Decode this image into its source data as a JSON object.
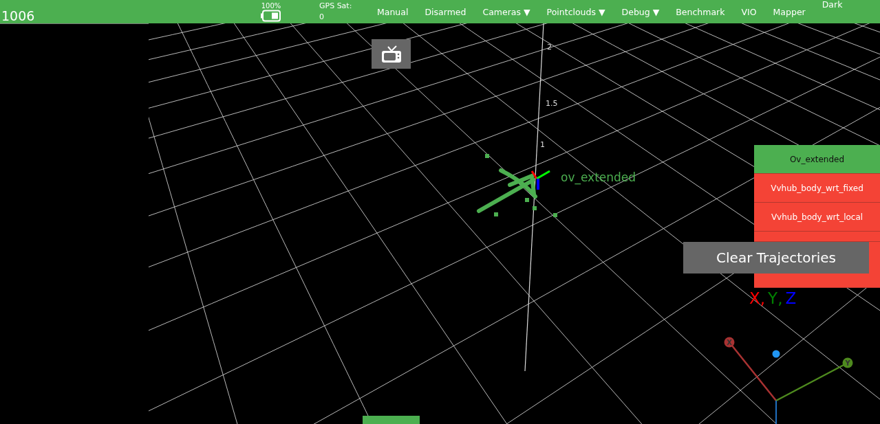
{
  "navbar": {
    "reading": "1006",
    "battery_label": "100%",
    "gps": {
      "label": "GPS Sat:",
      "value": "0"
    },
    "items": [
      {
        "label": "Manual",
        "kind": "link"
      },
      {
        "label": "Disarmed",
        "kind": "link"
      },
      {
        "label": "Cameras ▼",
        "kind": "link"
      },
      {
        "label": "Pointclouds ▼",
        "kind": "link"
      },
      {
        "label": "Debug ▼",
        "kind": "link"
      },
      {
        "label": "Benchmark",
        "kind": "link"
      },
      {
        "label": "VIO",
        "kind": "link"
      },
      {
        "label": "Mapper",
        "kind": "link"
      },
      {
        "label": "Dark",
        "kind": "toggle"
      }
    ]
  },
  "scene_labels": [
    {
      "text": "2",
      "kind": "tick"
    },
    {
      "text": "1.5",
      "kind": "tick"
    },
    {
      "text": "1",
      "kind": "tick"
    },
    {
      "text": "ov_extended",
      "kind": "frame"
    }
  ],
  "trajectories": [
    {
      "label": "Ov_extended",
      "enabled": true
    },
    {
      "label": "Vvhub_body_wrt_fixed",
      "enabled": false
    },
    {
      "label": "Vvhub_body_wrt_local",
      "enabled": false
    },
    {
      "enabled": false
    },
    {
      "enabled": false
    }
  ],
  "clear_button": "Clear Trajectories",
  "axis_legend": [
    {
      "label": "X,",
      "color": "#ff0000"
    },
    {
      "label": "Y,",
      "color": "#008000"
    },
    {
      "label": "Z",
      "color": "#0000ff"
    }
  ],
  "gizmo_labels": [
    "X",
    "Y"
  ]
}
